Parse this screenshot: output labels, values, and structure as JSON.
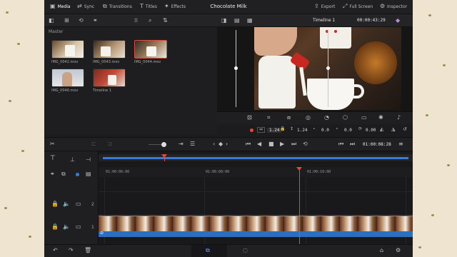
{
  "nav": {
    "media": "Media",
    "sync": "Sync",
    "transitions": "Transitions",
    "titles": "Titles",
    "effects": "Effects",
    "project_title": "Chocolate Milk",
    "export": "Export",
    "full_screen": "Full Screen",
    "inspector": "Inspector"
  },
  "media_pool": {
    "bin": "Master",
    "clips": [
      {
        "label": "IMG_0042.mov"
      },
      {
        "label": "IMG_0043.mov"
      },
      {
        "label": "IMG_0044.mov"
      },
      {
        "label": "IMG_0046.mov"
      },
      {
        "label": "Timeline 1"
      }
    ]
  },
  "viewer": {
    "timeline_name": "Timeline 1",
    "timecode": "00:00:43:29"
  },
  "inspector": {
    "zoom_value": "1.24",
    "zoom_value_2": "1.24",
    "position_x": "0.0",
    "position_y": "0.0",
    "rotation": "0.00"
  },
  "transport": {
    "timecode": "01:00:08:28"
  },
  "timeline": {
    "ruler": [
      "01:00:06:00",
      "01:00:08:00",
      "01:00:10:00"
    ],
    "tracks": [
      "2",
      "1"
    ]
  },
  "colors": {
    "playhead": "#e04a3c",
    "accent_blue": "#3a7bd5",
    "selected_border": "#e04a3c"
  }
}
